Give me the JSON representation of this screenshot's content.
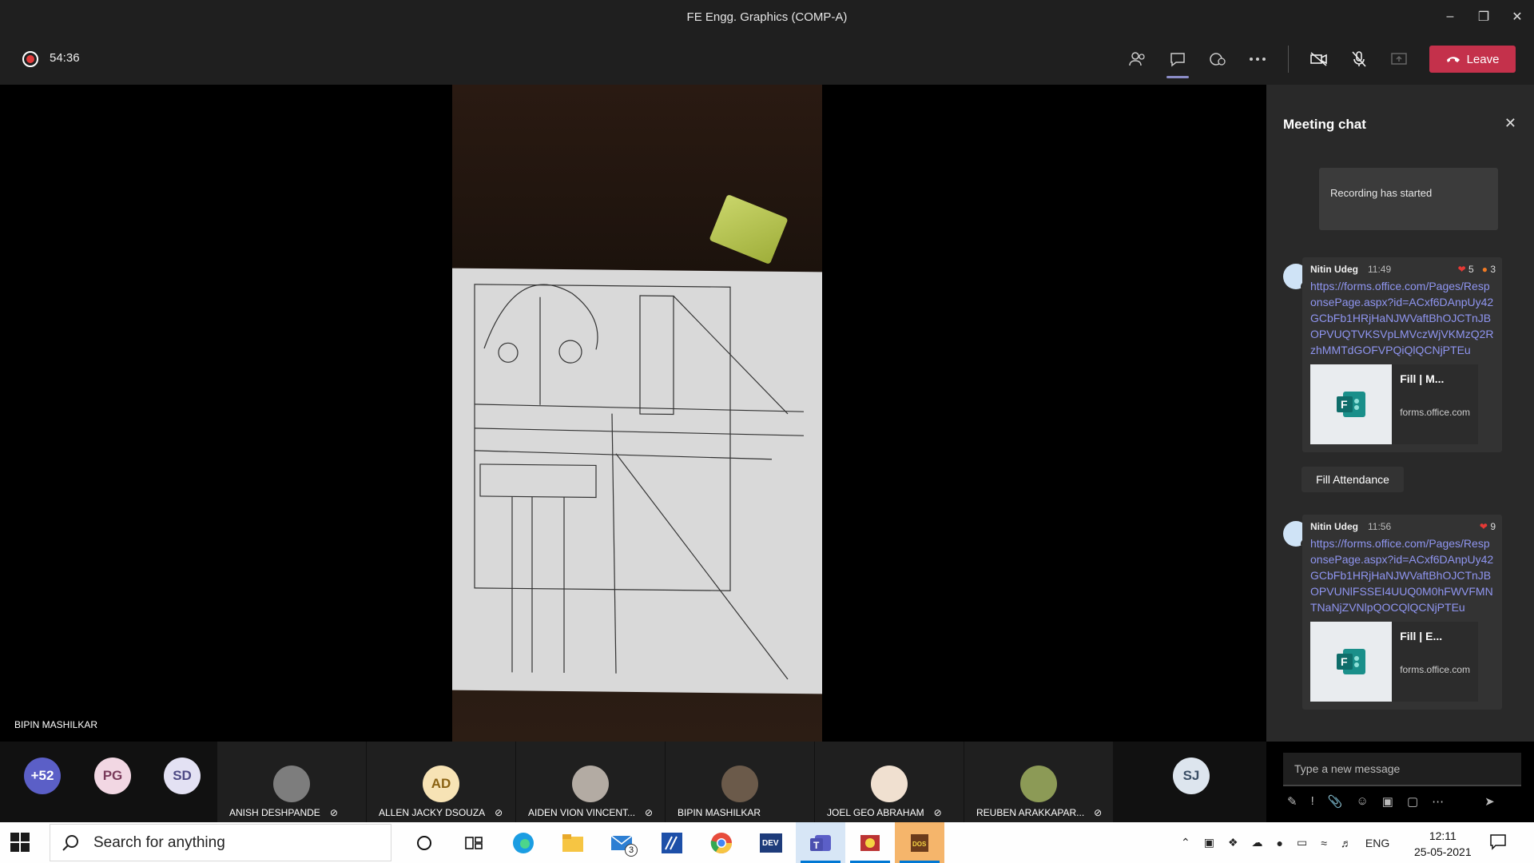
{
  "window": {
    "title": "FE Engg. Graphics (COMP-A)"
  },
  "toolbar": {
    "timer": "54:36",
    "leave_label": "Leave"
  },
  "video": {
    "speaker_name": "BIPIN MASHILKAR"
  },
  "chat": {
    "title": "Meeting chat",
    "system_message": "Recording has started",
    "messages": [
      {
        "author": "Nitin Udeg",
        "time": "11:49",
        "reactions": [
          {
            "icon": "heart-icon",
            "count": "5"
          },
          {
            "icon": "angry-icon",
            "count": "3"
          }
        ],
        "link": "https://forms.office.com/Pages/ResponsePage.aspx?id=ACxf6DAnpUy42GCbFb1HRjHaNJWVaftBhOJCTnJBOPVUQTVKSVpLMVczWjVKMzQ2RzhMMTdGOFVPQiQlQCNjPTEu",
        "card_title": "Fill | M...",
        "card_source": "forms.office.com"
      },
      {
        "author": "Nitin Udeg",
        "time": "11:56",
        "reactions": [
          {
            "icon": "heart-icon",
            "count": "9"
          }
        ],
        "link": "https://forms.office.com/Pages/ResponsePage.aspx?id=ACxf6DAnpUy42GCbFb1HRjHaNJWVaftBhOJCTnJBOPVUNlFSSEI4UUQ0M0hFWVFMNTNaNjZVNlpQOCQlQCNjPTEu",
        "card_title": "Fill | E...",
        "card_source": "forms.office.com"
      }
    ],
    "chip_label": "Fill Attendance",
    "compose_placeholder": "Type a new message"
  },
  "participants": {
    "overflow_count": "+52",
    "initials": [
      "PG",
      "SD",
      "SJ"
    ],
    "tiles": [
      {
        "name": "ANISH DESHPANDE"
      },
      {
        "name": "ALLEN JACKY DSOUZA",
        "initials": "AD"
      },
      {
        "name": "AIDEN VION VINCENT..."
      },
      {
        "name": "BIPIN MASHILKAR"
      },
      {
        "name": "JOEL GEO ABRAHAM"
      },
      {
        "name": "REUBEN ARAKKAPAR..."
      }
    ]
  },
  "taskbar": {
    "search_placeholder": "Search for anything",
    "mail_badge": "3",
    "language": "ENG",
    "time": "12:11",
    "date": "25-05-2021"
  },
  "colors": {
    "leave": "#c4314b",
    "link": "#8f95f0",
    "accent": "#8b8cc7"
  }
}
